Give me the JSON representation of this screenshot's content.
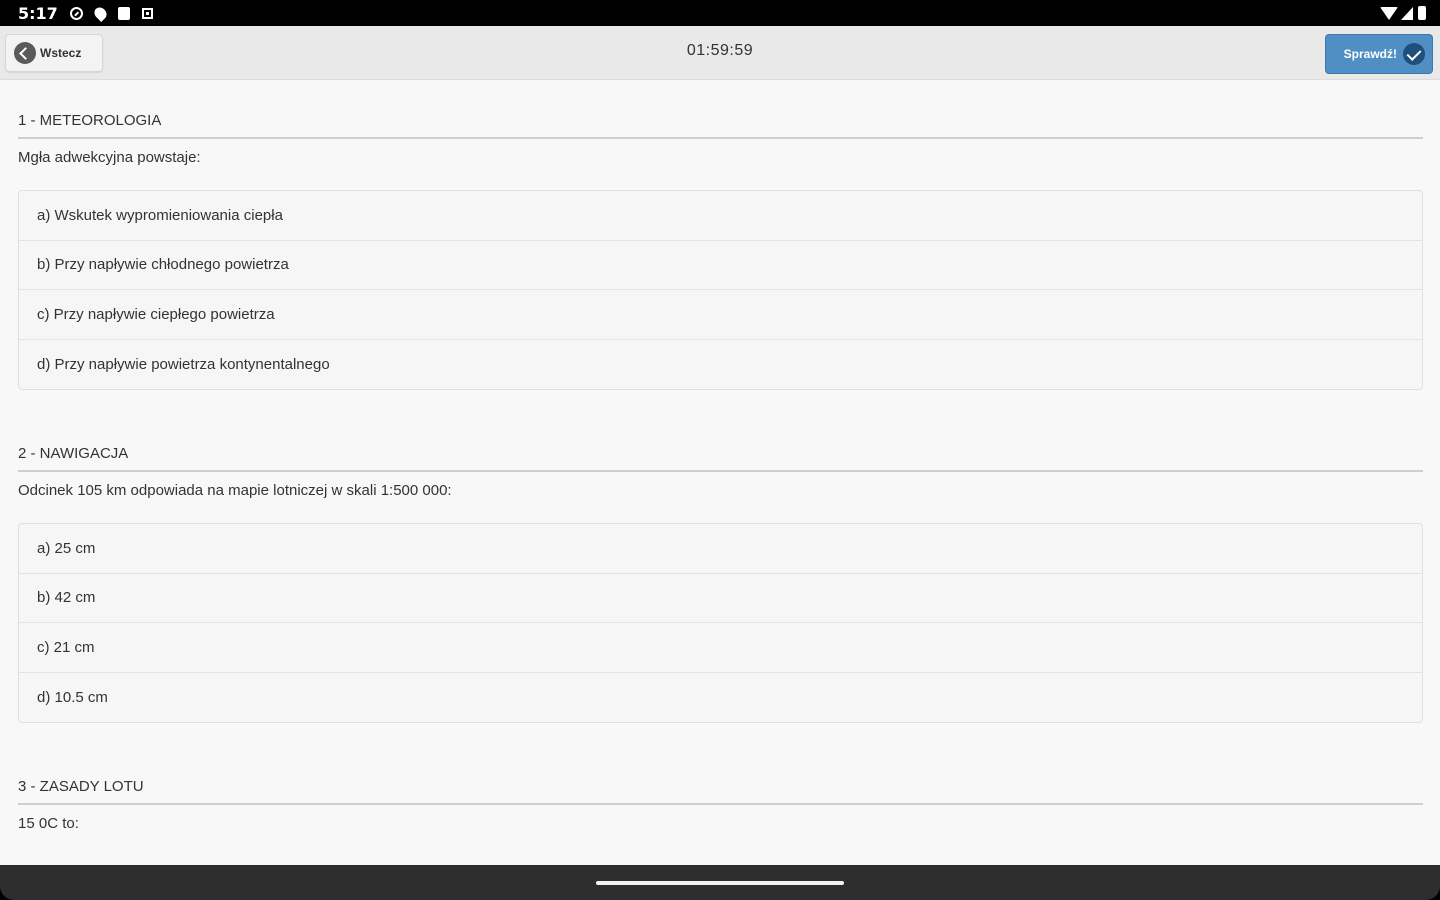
{
  "status_bar": {
    "time": "5:17",
    "left_icons": [
      "shield-icon",
      "location-icon",
      "sim-card-icon",
      "square-icon"
    ],
    "right_icons": [
      "wifi-icon",
      "signal-icon",
      "battery-icon"
    ]
  },
  "toolbar": {
    "back_label": "Wstecz",
    "timer": "01:59:59",
    "check_label": "Sprawdź!",
    "check_color": "#4f8fc4"
  },
  "questions": [
    {
      "header": "1 - METEOROLOGIA",
      "text": "Mgła adwekcyjna powstaje:",
      "answers": [
        "a) Wskutek wypromieniowania ciepła",
        "b) Przy napływie chłodnego powietrza",
        "c) Przy napływie ciepłego powietrza",
        "d) Przy napływie powietrza kontynentalnego"
      ]
    },
    {
      "header": "2 - NAWIGACJA",
      "text": "Odcinek 105 km odpowiada na mapie lotniczej w skali 1:500 000:",
      "answers": [
        "a) 25 cm",
        "b) 42 cm",
        "c) 21 cm",
        "d) 10.5 cm"
      ]
    },
    {
      "header": "3 - ZASADY LOTU",
      "text": "15 0C to:",
      "answers": []
    }
  ]
}
